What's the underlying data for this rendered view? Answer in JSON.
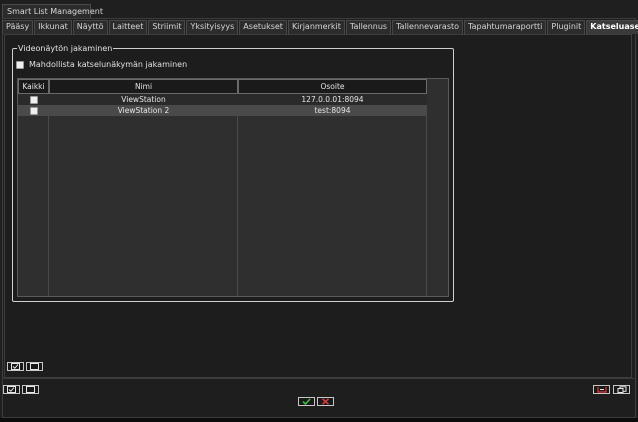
{
  "window": {
    "title": "Smart List Management"
  },
  "tabs": [
    {
      "label": "Pääsy"
    },
    {
      "label": "Ikkunat"
    },
    {
      "label": "Näyttö"
    },
    {
      "label": "Laitteet"
    },
    {
      "label": "Striimit"
    },
    {
      "label": "Yksityisyys"
    },
    {
      "label": "Asetukset"
    },
    {
      "label": "Kirjanmerkit"
    },
    {
      "label": "Tallennus"
    },
    {
      "label": "Tallennevarasto"
    },
    {
      "label": "Tapahtumaraportti"
    },
    {
      "label": "Pluginit"
    },
    {
      "label": "Katselu­asemat"
    }
  ],
  "active_tab": "Katseluasemat",
  "group": {
    "title": "Videonäytön jakaminen",
    "enable_label": "Mahdollista katselunäkymän jakaminen",
    "enable_checked": false
  },
  "table": {
    "headers": {
      "all": "Kaikki",
      "name": "Nimi",
      "address": "Osoite"
    },
    "rows": [
      {
        "name": "ViewStation",
        "address": "127.0.0.01:8094",
        "checked": false
      },
      {
        "name": "ViewStation 2",
        "address": "test:8094",
        "checked": false
      }
    ]
  },
  "icons": {
    "select_all": "checkbox-checked-icon",
    "select_none": "checkbox-empty-icon",
    "ok": "checkmark-icon",
    "cancel": "x-icon",
    "apply": "apply-icon",
    "reset": "reset-icon"
  },
  "colors": {
    "ok": "#3fbf3f",
    "cancel": "#e03a3a",
    "apply": "#e03a3a"
  }
}
